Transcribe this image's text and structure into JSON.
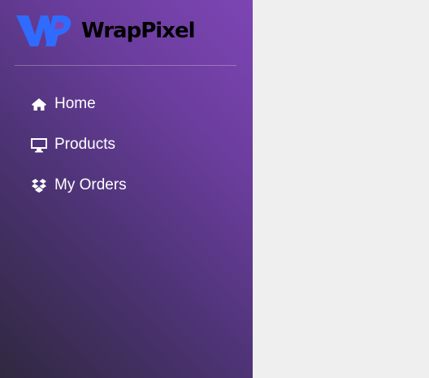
{
  "brand": {
    "name": "WrapPixel",
    "logo_icon": "wrappixel-logo-icon"
  },
  "sidebar": {
    "items": [
      {
        "label": "Home",
        "icon": "home-icon"
      },
      {
        "label": "Products",
        "icon": "monitor-icon"
      },
      {
        "label": "My Orders",
        "icon": "dropbox-icon"
      }
    ]
  },
  "colors": {
    "sidebar_gradient_start": "#7d45b4",
    "sidebar_gradient_end": "#302840",
    "logo_primary": "#2f6bff",
    "content_background": "#efefef",
    "nav_text": "#ffffff"
  }
}
